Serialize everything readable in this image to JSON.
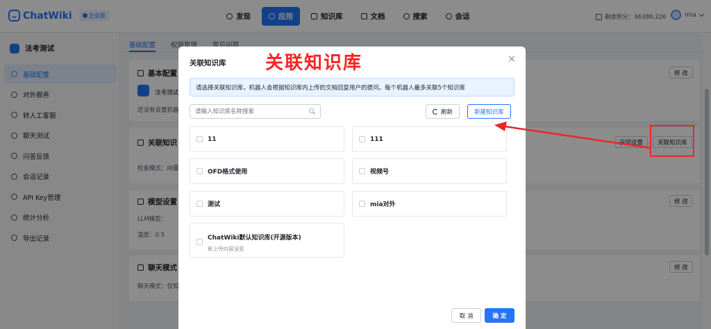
{
  "app": {
    "logo_text": "ChatWiki",
    "edition": "企业版"
  },
  "nav": [
    {
      "label": "发现",
      "icon": "discover-icon",
      "active": false
    },
    {
      "label": "应用",
      "icon": "apps-icon",
      "active": true
    },
    {
      "label": "知识库",
      "icon": "knowledge-base-icon",
      "active": false
    },
    {
      "label": "文档",
      "icon": "document-icon",
      "active": false
    },
    {
      "label": "搜索",
      "icon": "search-icon",
      "active": false
    },
    {
      "label": "会话",
      "icon": "chat-icon",
      "active": false
    }
  ],
  "header": {
    "points": "剩余积分：96386.226",
    "user": "mia"
  },
  "sidebar": {
    "robot_name": "法考测试",
    "items": [
      {
        "label": "基础配置",
        "active": true
      },
      {
        "label": "对外服务"
      },
      {
        "label": "转人工客服"
      },
      {
        "label": "聊天测试"
      },
      {
        "label": "问答反馈"
      },
      {
        "label": "会话记录"
      },
      {
        "label": "API Key管理"
      },
      {
        "label": "统计分析"
      },
      {
        "label": "导出记录"
      }
    ]
  },
  "tabs": [
    "基础配置",
    "权限管理",
    "常见问题"
  ],
  "cards": {
    "basic": {
      "title": "基本配置",
      "name": "法考测试",
      "text": "还没有设置机器",
      "edit": "修 改"
    },
    "kb": {
      "title": "关联知识",
      "text": "检索模式：向量",
      "recall": "召回设置",
      "link": "关联知识库"
    },
    "model": {
      "title": "模型设置",
      "llm": "LLM模型：",
      "temp": "温度：0.5",
      "edit": "修 改"
    },
    "chat": {
      "title": "聊天模式",
      "text": "聊天模式：仅知",
      "edit": "修 改"
    }
  },
  "modal": {
    "title": "关联知识库",
    "annotation": "关联知识库",
    "notice": "请选择关联知识库，机器人会根据知识库内上传的文档回复用户的提问。每个机器人最多关联5个知识库",
    "search_placeholder": "请输入知识库名称搜索",
    "refresh": "刷新",
    "new_kb": "新建知识库",
    "items": [
      {
        "name": "11"
      },
      {
        "name": "111"
      },
      {
        "name": "OFD格式使用"
      },
      {
        "name": "视频号"
      },
      {
        "name": "测试"
      },
      {
        "name": "mia对外"
      },
      {
        "name": "ChatWiki默认知识库(开源版本)",
        "desc": "新上传内容没变"
      }
    ],
    "cancel": "取 消",
    "ok": "确 定"
  },
  "colors": {
    "primary": "#2475fc",
    "annotation_red": "#e8272b"
  }
}
